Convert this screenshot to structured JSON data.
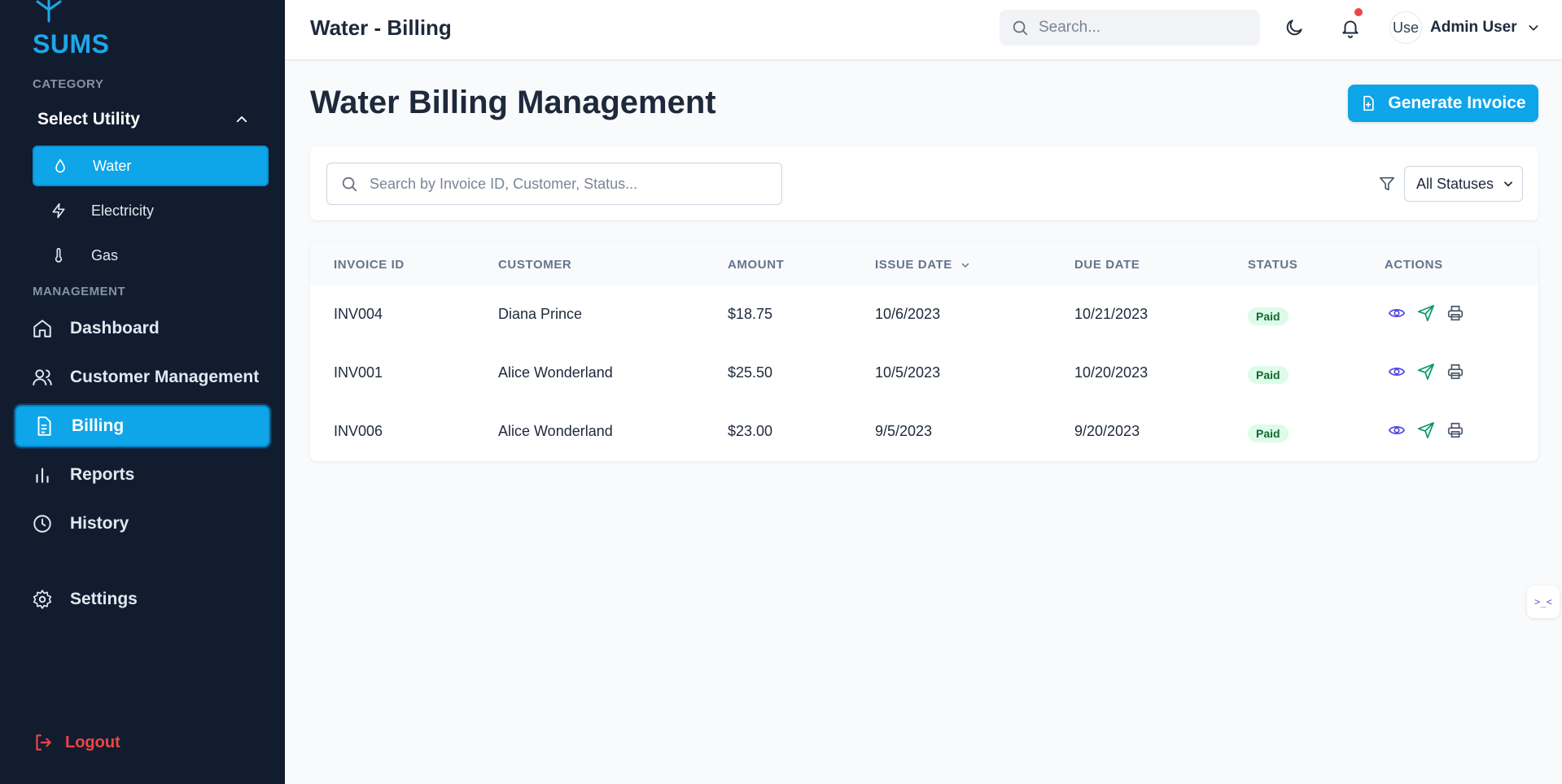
{
  "brand": {
    "name": "SUMS",
    "color": "#1ea7e9"
  },
  "sidebar": {
    "category_label": "CATEGORY",
    "utility_toggle": "Select Utility",
    "utilities": [
      {
        "label": "Water",
        "icon": "droplet-icon",
        "active": true
      },
      {
        "label": "Electricity",
        "icon": "bolt-icon",
        "active": false
      },
      {
        "label": "Gas",
        "icon": "thermometer-icon",
        "active": false
      }
    ],
    "management_label": "MANAGEMENT",
    "nav": [
      {
        "label": "Dashboard",
        "icon": "home-icon"
      },
      {
        "label": "Customer Management",
        "icon": "users-icon"
      },
      {
        "label": "Billing",
        "icon": "document-icon",
        "active": true
      },
      {
        "label": "Reports",
        "icon": "bar-chart-icon"
      },
      {
        "label": "History",
        "icon": "clock-icon"
      },
      {
        "label": "Settings",
        "icon": "gear-icon"
      }
    ],
    "logout": "Logout"
  },
  "header": {
    "title": "Water - Billing",
    "search_placeholder": "Search...",
    "user_name": "Admin User",
    "avatar_alt": "Use"
  },
  "main": {
    "title": "Water Billing Management",
    "generate_button": "Generate Invoice",
    "filter_placeholder": "Search by Invoice ID, Customer, Status...",
    "status_filter": "All Statuses"
  },
  "table": {
    "columns": [
      "INVOICE ID",
      "CUSTOMER",
      "AMOUNT",
      "ISSUE DATE",
      "DUE DATE",
      "STATUS",
      "ACTIONS"
    ],
    "rows": [
      {
        "id": "INV004",
        "customer": "Diana Prince",
        "amount": "$18.75",
        "issue": "10/6/2023",
        "due": "10/21/2023",
        "status": "Paid"
      },
      {
        "id": "INV001",
        "customer": "Alice Wonderland",
        "amount": "$25.50",
        "issue": "10/5/2023",
        "due": "10/20/2023",
        "status": "Paid"
      },
      {
        "id": "INV006",
        "customer": "Alice Wonderland",
        "amount": "$23.00",
        "issue": "9/5/2023",
        "due": "9/20/2023",
        "status": "Paid"
      }
    ]
  },
  "widget": {
    "label": ">_<"
  },
  "colors": {
    "accent": "#0ea5e9",
    "sidebar_bg": "#111c2f",
    "logout": "#ef4444",
    "paid_bg": "#dcfce7",
    "paid_text": "#166534"
  }
}
